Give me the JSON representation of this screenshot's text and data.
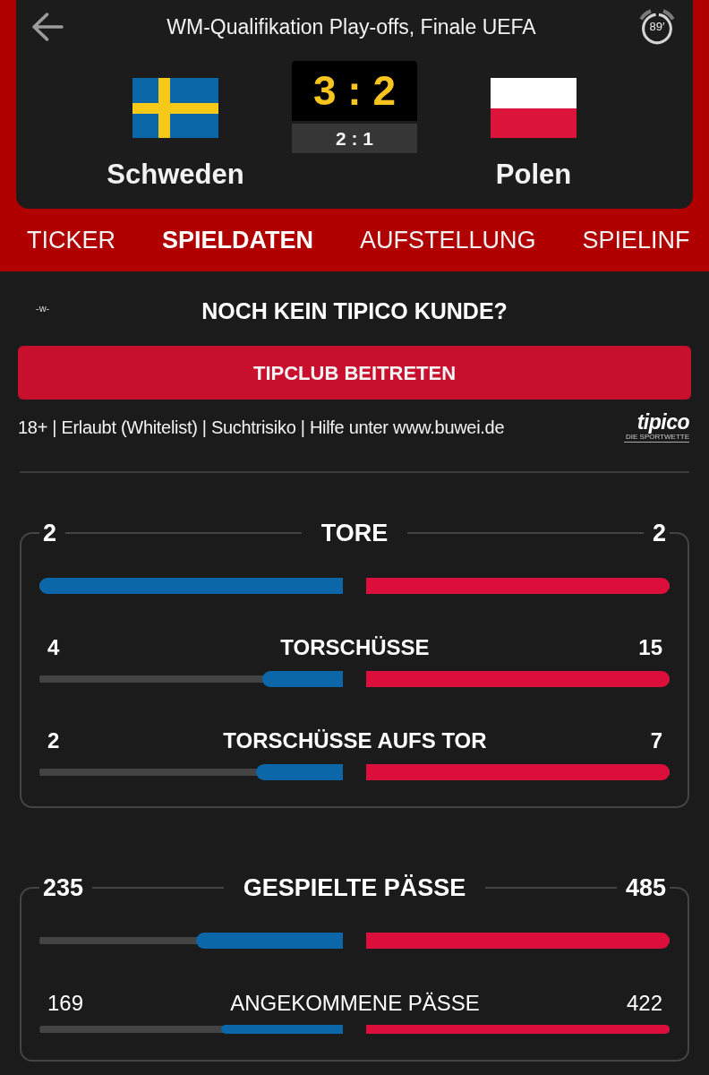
{
  "header": {
    "title": "WM-Qualifikation Play-offs, Finale UEFA",
    "minute": "89′"
  },
  "teams": [
    {
      "name": "Schweden",
      "kind": "cross"
    },
    {
      "name": "Polen",
      "kind": "bicolor"
    }
  ],
  "score": {
    "full": "3 : 2",
    "half": "2 : 1"
  },
  "tabs": [
    {
      "label": "TICKER",
      "selected": false
    },
    {
      "label": "SPIELDATEN",
      "selected": true
    },
    {
      "label": "AUFSTELLUNG",
      "selected": false
    },
    {
      "label": "SPIELINF",
      "selected": false
    }
  ],
  "ad": {
    "tag": "-w-",
    "headline": "NOCH KEIN TIPICO KUNDE?",
    "button": "TIPCLUB BEITRETEN",
    "disclaimer": "18+ | Erlaubt (Whitelist) | Suchtrisiko | Hilfe unter www.buwei.de",
    "logo": {
      "wordmark": "tipico",
      "tagline": "DIE SPORTWETTE"
    }
  },
  "stat_groups": [
    {
      "rows": [
        {
          "kind": "header",
          "label": "TORE",
          "home": {
            "value": "2",
            "level": 1
          },
          "away": {
            "value": "2",
            "level": 1
          }
        },
        {
          "kind": "main",
          "label": "TORSCHÜSSE",
          "home": {
            "value": "4",
            "level": 0.267
          },
          "away": {
            "value": "15",
            "level": 1
          }
        },
        {
          "kind": "main",
          "label": "TORSCHÜSSE AUFS TOR",
          "home": {
            "value": "2",
            "level": 0.286
          },
          "away": {
            "value": "7",
            "level": 1
          }
        }
      ]
    },
    {
      "rows": [
        {
          "kind": "header",
          "label": "GESPIELTE PÄSSE",
          "home": {
            "value": "235",
            "level": 0.485
          },
          "away": {
            "value": "485",
            "level": 1
          }
        },
        {
          "kind": "sub",
          "label": "ANGEKOMMENE PÄSSE",
          "home": {
            "value": "169",
            "level": 0.4
          },
          "away": {
            "value": "422",
            "level": 1
          }
        }
      ]
    }
  ]
}
